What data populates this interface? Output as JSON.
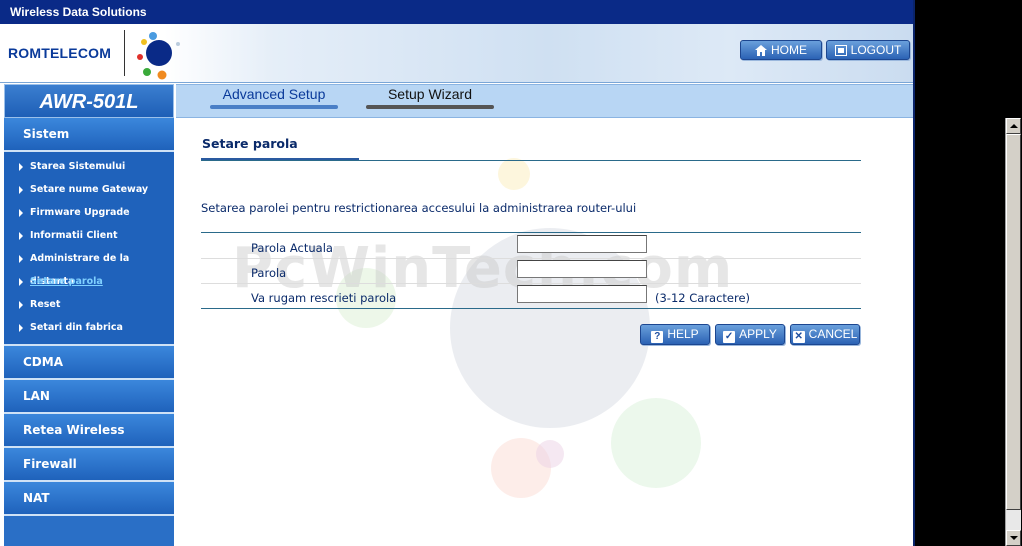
{
  "window": {
    "title": "Wireless Data Solutions"
  },
  "header": {
    "brand": "ROMTELECOM",
    "home_label": "HOME",
    "logout_label": "LOGOUT"
  },
  "model": "AWR-501L",
  "tabs": [
    {
      "label": "Advanced Setup"
    },
    {
      "label": "Setup Wizard"
    }
  ],
  "sidebar": {
    "sections": [
      {
        "label": "Sistem"
      },
      {
        "label": "CDMA"
      },
      {
        "label": "LAN"
      },
      {
        "label": "Retea Wireless"
      },
      {
        "label": "Firewall"
      },
      {
        "label": "NAT"
      }
    ],
    "sistem_items": [
      {
        "label": "Starea Sistemului"
      },
      {
        "label": "Setare nume Gateway"
      },
      {
        "label": "Firmware Upgrade"
      },
      {
        "label": "Informatii Client"
      },
      {
        "label": "Administrare de la distanta"
      },
      {
        "label": "Setare parola",
        "active": true
      },
      {
        "label": "Reset"
      },
      {
        "label": "Setari din fabrica"
      }
    ]
  },
  "main": {
    "title": "Setare parola",
    "description": "Setarea parolei pentru restrictionarea accesului la administrarea router-ului",
    "watermark": "PcWinTech.com",
    "fields": [
      {
        "label": "Parola Actuala",
        "value": ""
      },
      {
        "label": "Parola",
        "value": ""
      },
      {
        "label": "Va rugam rescrieti parola",
        "value": "",
        "hint": "(3-12 Caractere)"
      }
    ],
    "buttons": {
      "help": "HELP",
      "apply": "APPLY",
      "cancel": "CANCEL"
    }
  },
  "colors": {
    "titlebar": "#0a2a87",
    "sidebar": "#2a6fc6",
    "active_item": "#7fd0ff",
    "button": "#2b62b4"
  }
}
